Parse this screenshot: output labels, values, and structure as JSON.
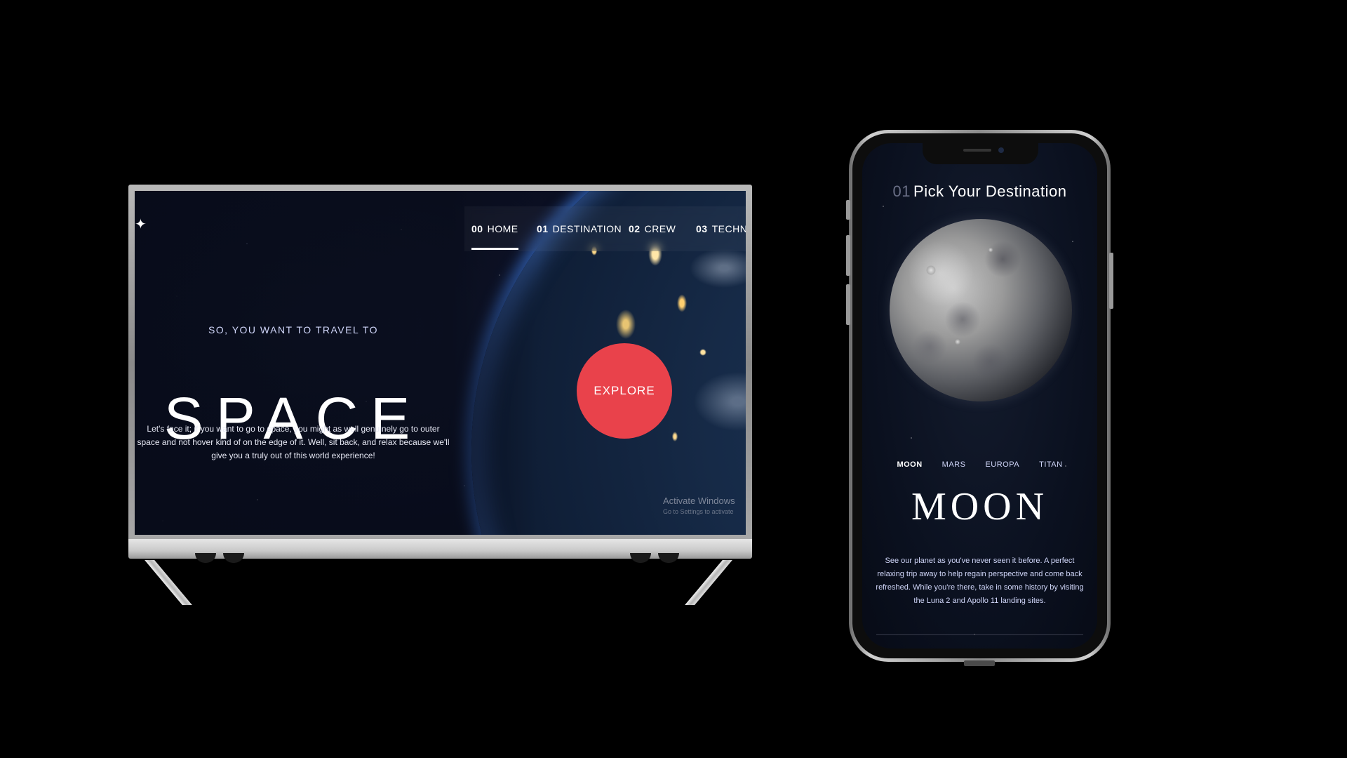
{
  "tv": {
    "logo_glyph": "✦",
    "nav": [
      {
        "num": "00",
        "label": "HOME",
        "active": true
      },
      {
        "num": "01",
        "label": "DESTINATION",
        "active": false
      },
      {
        "num": "02",
        "label": "CREW",
        "active": false
      },
      {
        "num": "03",
        "label": "TECHNO",
        "active": false
      }
    ],
    "eyebrow": "SO, YOU WANT TO TRAVEL TO",
    "title": "SPACE",
    "description": "Let's face it; if you want to go to space, you might as well genuinely go to outer space and not hover kind of on the edge of it. Well, sit back, and relax because we'll give you a truly out of this world experience!",
    "explore_label": "EXPLORE",
    "watermark": "Activate Windows",
    "watermark_sub": "Go to Settings to activate"
  },
  "phone": {
    "heading_num": "01",
    "heading_text": "Pick Your Destination",
    "tabs": [
      {
        "label": "MOON",
        "active": true
      },
      {
        "label": "MARS",
        "active": false
      },
      {
        "label": "EUROPA",
        "active": false
      },
      {
        "label": "TITAN",
        "active": false
      }
    ],
    "planet_name": "MOON",
    "description": "See our planet as you've never seen it before. A perfect relaxing trip away to help regain perspective and come back refreshed. While you're there, take in some history by visiting the Luna 2 and Apollo 11 landing sites."
  },
  "colors": {
    "accent": "#e9424b",
    "bg": "#000000",
    "screen_bg": "#0b0f22",
    "muted_text": "#d0d6f9"
  }
}
